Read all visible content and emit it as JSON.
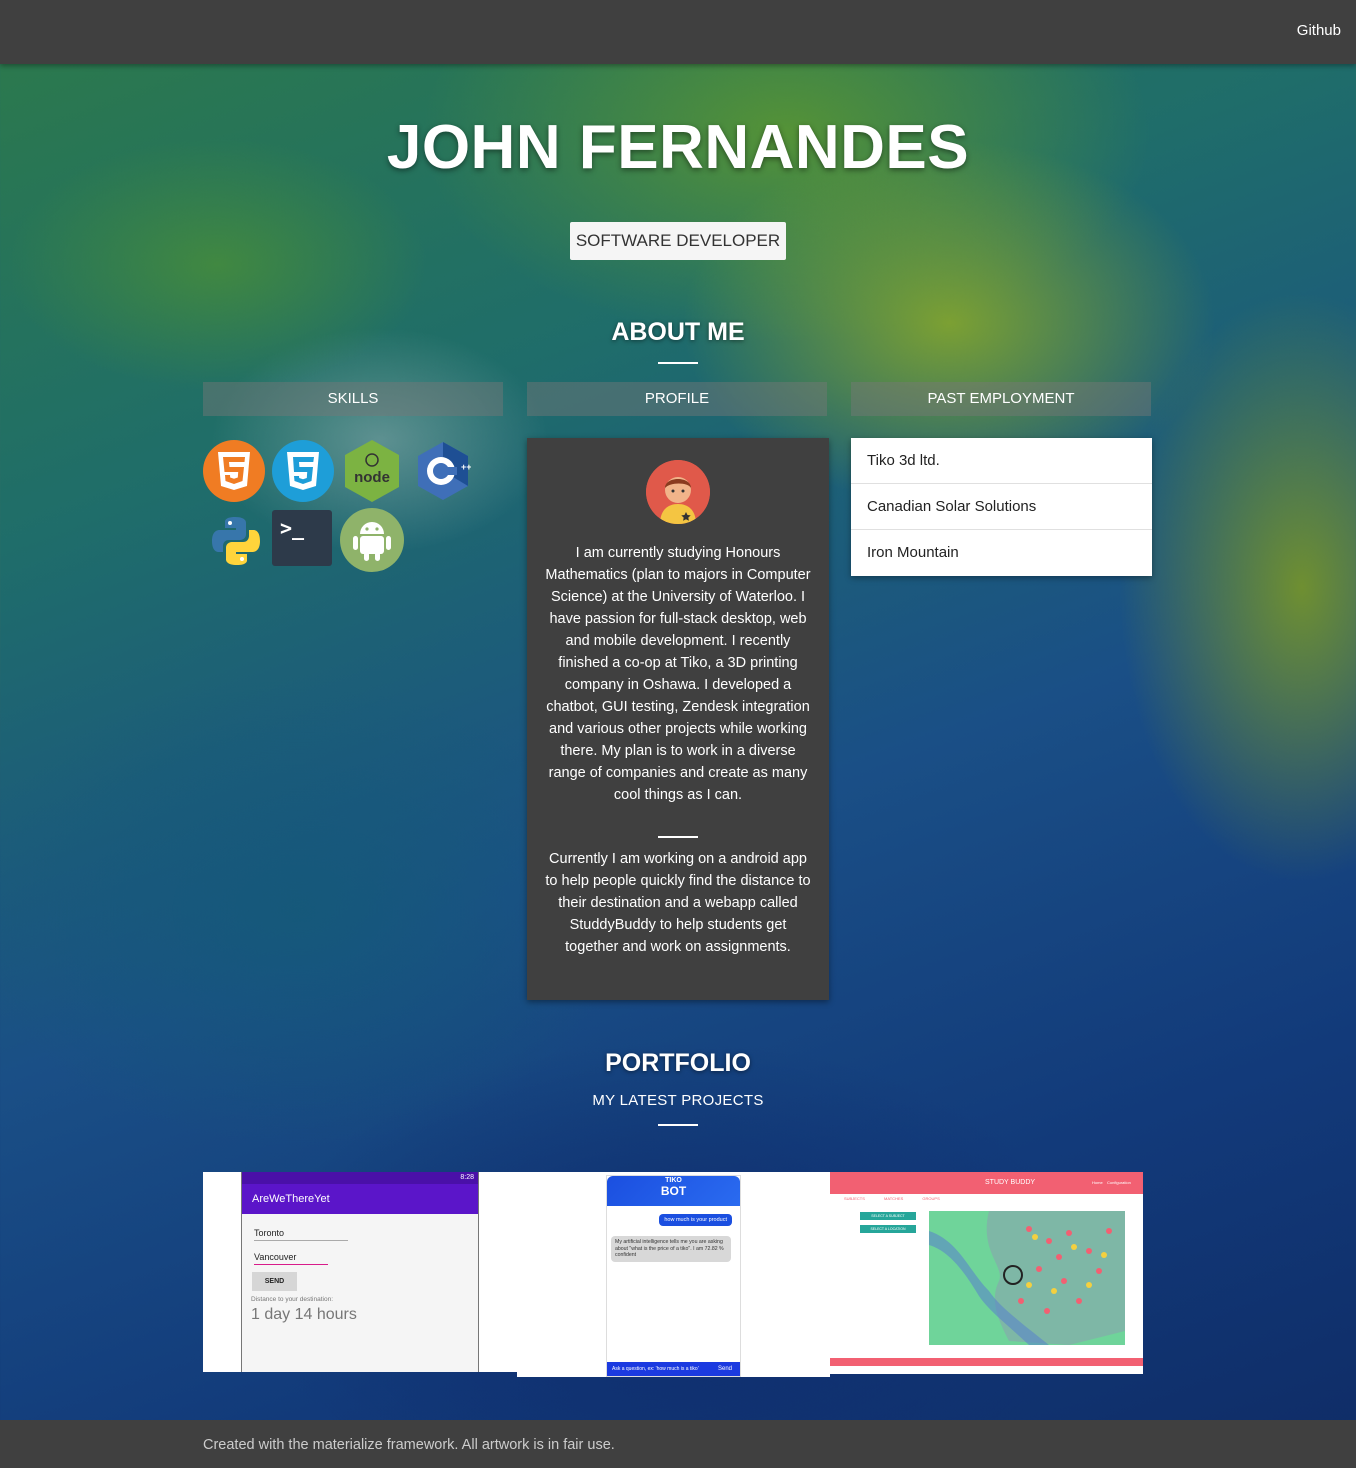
{
  "nav": {
    "github_label": "Github"
  },
  "hero": {
    "name": "JOHN FERNANDES",
    "role": "SOFTWARE DEVELOPER"
  },
  "about": {
    "title": "ABOUT ME",
    "tabs": [
      {
        "label": "SKILLS"
      },
      {
        "label": "PROFILE"
      },
      {
        "label": "PAST EMPLOYMENT"
      }
    ],
    "skills": [
      {
        "icon": "html5-icon",
        "label": "HTML",
        "color": "#f07c23"
      },
      {
        "icon": "css3-icon",
        "label": "3",
        "color": "#1e9ed8"
      },
      {
        "icon": "nodejs-icon",
        "label": "node",
        "color": "#7cb342"
      },
      {
        "icon": "cpp-icon",
        "label": "C++",
        "color": "#3f6fb8"
      },
      {
        "icon": "python-icon",
        "label": "",
        "color": "#3776ab"
      },
      {
        "icon": "terminal-icon",
        "label": ">_",
        "color": "#2d3a4a"
      },
      {
        "icon": "android-icon",
        "label": "",
        "color": "#8fb36a"
      }
    ],
    "profile": {
      "bio_1": "I am currently studying Honours Mathematics (plan to majors in Computer Science) at the University of Waterloo. I have passion for full-stack desktop, web and mobile development. I recently finished a co-op at Tiko, a 3D printing company in Oshawa. I developed a chatbot, GUI testing, Zendesk integration and various other projects while working there. My plan is to work in a diverse range of companies and create as many cool things as I can.",
      "bio_2": "Currently I am working on a android app to help people quickly find the distance to their destination and a webapp called StuddyBuddy to help students get together and work on assignments."
    },
    "employment": [
      {
        "company": "Tiko 3d ltd."
      },
      {
        "company": "Canadian Solar Solutions"
      },
      {
        "company": "Iron Mountain"
      }
    ]
  },
  "portfolio": {
    "title": "PORTFOLIO",
    "subtitle": "MY LATEST PROJECTS",
    "projects": [
      {
        "app_title": "AreWeThereYet",
        "status_time": "8:28",
        "from": "Toronto",
        "to": "Vancouver",
        "send": "SEND",
        "distance_label": "Distance to your destination:",
        "distance_value": "1 day 14 hours"
      },
      {
        "brand_top": "TIKO",
        "brand_bottom": "BOT",
        "user_msg": "how much is your product",
        "bot_msg": "My artificial intelligence tells me you are asking about \"what is the price of a tiko\". I am 72.82 % confident",
        "input_placeholder": "Ask a question, ex: 'how much is a tiko'",
        "send": "Send"
      },
      {
        "app_title": "STUDY BUDDY",
        "nav_items": [
          "Home",
          "Configuration"
        ],
        "tabs": [
          "SUBJECTS",
          "MATCHES",
          "GROUPS"
        ],
        "btn_subject": "SELECT A SUBJECT",
        "btn_location": "SELECT A LOCATION"
      }
    ]
  },
  "footer": {
    "text": "Created with the materialize framework. All artwork is in fair use."
  }
}
